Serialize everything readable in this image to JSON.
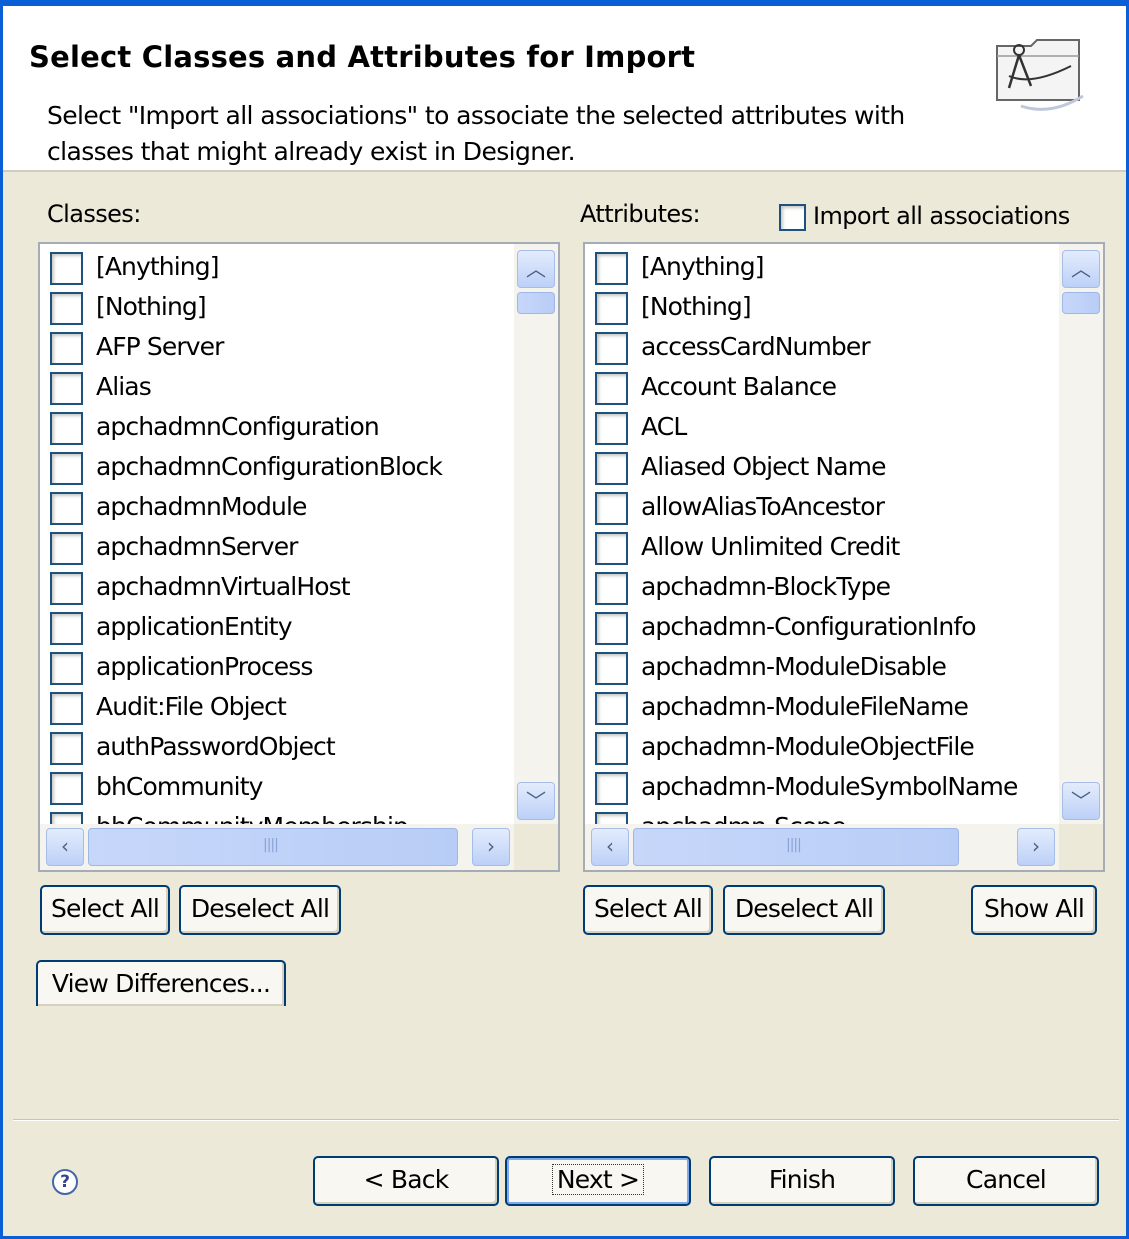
{
  "header": {
    "title": "Select Classes and Attributes for Import",
    "description": "Select \"Import all associations\" to associate the selected attributes with classes that might already exist in Designer."
  },
  "classes": {
    "label": "Classes:",
    "items": [
      {
        "label": "[Anything]",
        "checked": false
      },
      {
        "label": "[Nothing]",
        "checked": false
      },
      {
        "label": "AFP Server",
        "checked": false
      },
      {
        "label": "Alias",
        "checked": false
      },
      {
        "label": "apchadmnConfiguration",
        "checked": false
      },
      {
        "label": "apchadmnConfigurationBlock",
        "checked": false
      },
      {
        "label": "apchadmnModule",
        "checked": false
      },
      {
        "label": "apchadmnServer",
        "checked": false
      },
      {
        "label": "apchadmnVirtualHost",
        "checked": false
      },
      {
        "label": "applicationEntity",
        "checked": false
      },
      {
        "label": "applicationProcess",
        "checked": false
      },
      {
        "label": "Audit:File Object",
        "checked": false
      },
      {
        "label": "authPasswordObject",
        "checked": false
      },
      {
        "label": "bhCommunity",
        "checked": false
      },
      {
        "label": "bhCommunityMembership",
        "checked": false
      }
    ],
    "select_all": "Select All",
    "deselect_all": "Deselect All"
  },
  "attributes": {
    "label": "Attributes:",
    "import_all_label": "Import all associations",
    "import_all_checked": false,
    "items": [
      {
        "label": "[Anything]",
        "checked": false
      },
      {
        "label": "[Nothing]",
        "checked": false
      },
      {
        "label": "accessCardNumber",
        "checked": false
      },
      {
        "label": "Account Balance",
        "checked": false
      },
      {
        "label": "ACL",
        "checked": false
      },
      {
        "label": "Aliased Object Name",
        "checked": false
      },
      {
        "label": "allowAliasToAncestor",
        "checked": false
      },
      {
        "label": "Allow Unlimited Credit",
        "checked": false
      },
      {
        "label": "apchadmn-BlockType",
        "checked": false
      },
      {
        "label": "apchadmn-ConfigurationInfo",
        "checked": false
      },
      {
        "label": "apchadmn-ModuleDisable",
        "checked": false
      },
      {
        "label": "apchadmn-ModuleFileName",
        "checked": false
      },
      {
        "label": "apchadmn-ModuleObjectFile",
        "checked": false
      },
      {
        "label": "apchadmn-ModuleSymbolName",
        "checked": false
      },
      {
        "label": "apchadmn-Scope",
        "checked": false
      }
    ],
    "select_all": "Select All",
    "deselect_all": "Deselect All",
    "show_all": "Show All"
  },
  "view_differences": "View Differences...",
  "footer": {
    "help": "?",
    "back": "< Back",
    "next": "Next >",
    "finish": "Finish",
    "cancel": "Cancel"
  },
  "icons": {
    "scroll_up": "scroll-up-icon",
    "scroll_down": "scroll-down-icon",
    "scroll_left": "scroll-left-icon",
    "scroll_right": "scroll-right-icon",
    "wizard": "compass-folder-icon",
    "help": "help-icon"
  }
}
